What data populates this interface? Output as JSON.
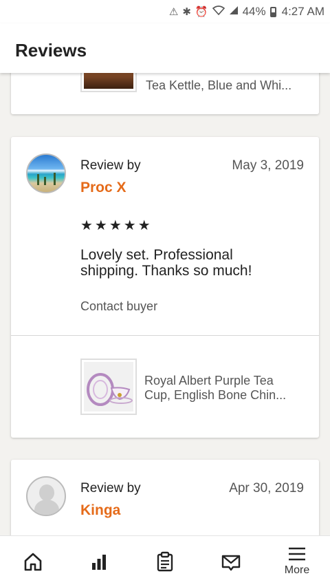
{
  "status_bar": {
    "battery": "44%",
    "time": "4:27 AM"
  },
  "header": {
    "title": "Reviews"
  },
  "previous_review": {
    "product_title": "Tea Kettle, Blue and Whi..."
  },
  "review": {
    "label": "Review by",
    "reviewer": "Proc X",
    "date": "May 3, 2019",
    "stars": "★★★★★",
    "rating": 5,
    "text": "Lovely set. Professional shipping. Thanks so much!",
    "contact": "Contact buyer",
    "product_title_line1": "Royal Albert Purple Tea",
    "product_title_line2": "Cup, English Bone Chin..."
  },
  "next_review": {
    "label": "Review by",
    "reviewer": "Kinga",
    "date": "Apr 30, 2019"
  },
  "bottom_nav": {
    "more_label": "More"
  },
  "colors": {
    "reviewer_accent": "#e56b1a",
    "page_background": "#f3f2ef"
  }
}
